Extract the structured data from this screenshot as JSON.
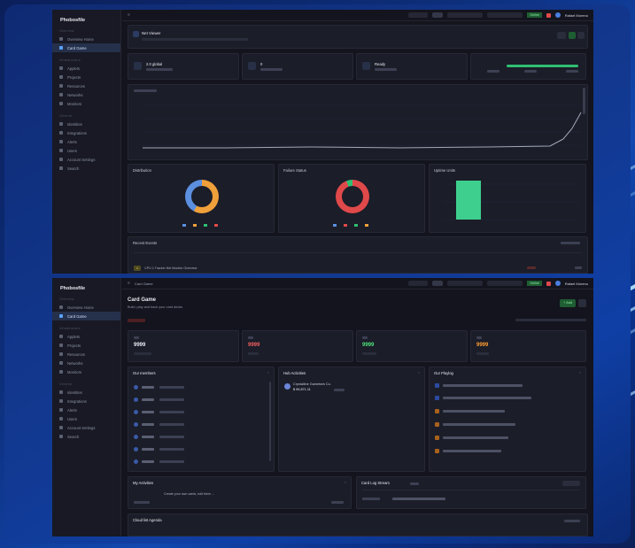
{
  "app": {
    "name": "Phobosfile"
  },
  "shot1": {
    "sidebar": {
      "groups": [
        "Overview",
        "Infrastructure",
        "General"
      ],
      "items": [
        "Overview Home",
        "Card Game",
        "Applets",
        "Projects",
        "Resources",
        "Networks",
        "Monitors",
        "Identities",
        "Integrations",
        "Alerts",
        "Users",
        "Account Settings",
        "Search"
      ]
    },
    "topbar": {
      "status": "Online",
      "user": "Rafael Moreno"
    },
    "header": {
      "title": "Net Viewer"
    },
    "stats": [
      {
        "title": "2.0 global"
      },
      {
        "title": "0"
      },
      {
        "title": "Ready"
      }
    ],
    "panels": {
      "donut_a": {
        "title": "Distribution"
      },
      "donut_b": {
        "title": "Failure Status"
      },
      "bar": {
        "title": "Uptime Units"
      },
      "activity": {
        "title": "Recent Events"
      }
    },
    "activity_row": "CPU 1 Tracker Net Monitor Overview"
  },
  "shot2": {
    "sidebar": {
      "groups": [
        "Overview",
        "Infrastructure",
        "General"
      ],
      "items": [
        "Overview Home",
        "Card Game",
        "Applets",
        "Projects",
        "Resources",
        "Networks",
        "Monitors",
        "Identities",
        "Integrations",
        "Alerts",
        "Users",
        "Account Settings",
        "Search"
      ]
    },
    "topbar": {
      "breadcrumb": "Card Game",
      "status": "Online",
      "user": "Rafael Moreno"
    },
    "header": {
      "title": "Card Game",
      "subtitle": "Build, play and track your card decks",
      "add_label": "+ Add"
    },
    "kpis": [
      {
        "value": "9999",
        "color": "#e8eaf1"
      },
      {
        "value": "9999",
        "color": "#f25f5c"
      },
      {
        "value": "9999",
        "color": "#4ee27a"
      },
      {
        "value": "9999",
        "color": "#ff9f2f"
      }
    ],
    "panels": {
      "members": {
        "title": "Our members"
      },
      "hub": {
        "title": "Hub Activities",
        "item": "Crystalline Gametwin Co.",
        "sub": "$ 99,871.11"
      },
      "log": {
        "title": "Our Playlog"
      },
      "left_bottom": {
        "title": "My Activities",
        "text": "Create your own cards, edit them ..."
      },
      "right_bottom": {
        "title": "Card Log Stream"
      },
      "footer": {
        "title": "Cloud list Agenda"
      }
    }
  },
  "colors": {
    "accent": "#5aa3ff",
    "bg": "#13141d",
    "panel": "#1b1d29",
    "green": "#2fbf71",
    "red": "#e0494a",
    "orange": "#f0a03a"
  }
}
